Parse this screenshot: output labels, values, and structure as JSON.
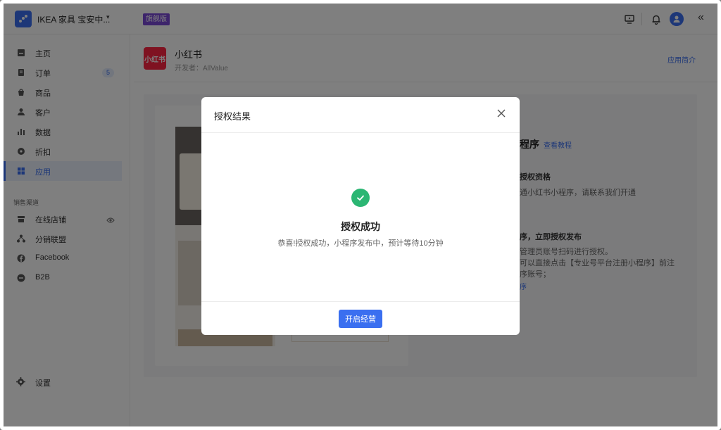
{
  "topbar": {
    "store_name": "IKEA 家具 宝安中...",
    "store_caret": "▾",
    "plan_badge": "旗舰版",
    "collapse_glyph": "«"
  },
  "sidebar": {
    "items": [
      {
        "label": "主页",
        "icon": "home-icon"
      },
      {
        "label": "订单",
        "icon": "order-icon",
        "badge": "5"
      },
      {
        "label": "商品",
        "icon": "goods-icon"
      },
      {
        "label": "客户",
        "icon": "customer-icon"
      },
      {
        "label": "数据",
        "icon": "chart-icon"
      },
      {
        "label": "折扣",
        "icon": "discount-icon"
      },
      {
        "label": "应用",
        "icon": "apps-icon",
        "active": true
      }
    ],
    "section_title": "销售渠道",
    "channels": [
      {
        "label": "在线店铺",
        "icon": "store-icon"
      },
      {
        "label": "分销联盟",
        "icon": "network-icon"
      },
      {
        "label": "Facebook",
        "icon": "facebook-icon"
      },
      {
        "label": "B2B",
        "icon": "b2b-icon"
      }
    ],
    "settings_label": "设置"
  },
  "app": {
    "logo_text": "小红书",
    "name": "小红书",
    "developer": "开发者：AllValue",
    "intro_link": "应用简介"
  },
  "guide": {
    "title": "程序",
    "tutorial_link": "查看教程",
    "step1_heading": "授权资格",
    "step1_text": "通小红书小程序，请联系我们开通",
    "step2_heading": "序，立即授权发布",
    "step2_line1": "管理员账号扫码进行授权。",
    "step2_line2": "可以直接点击【专业号平台注册小程序】前注",
    "step2_line3": "序账号；",
    "step2_link": "序"
  },
  "modal": {
    "title": "授权结果",
    "success_title": "授权成功",
    "success_desc": "恭喜!授权成功，小程序发布中，预计等待10分钟",
    "primary_button": "开启经营"
  },
  "colors": {
    "accent": "#3a6ff0",
    "success": "#2bb673",
    "plan_badge": "#7a48d6",
    "xhs_red": "#ff2442"
  }
}
